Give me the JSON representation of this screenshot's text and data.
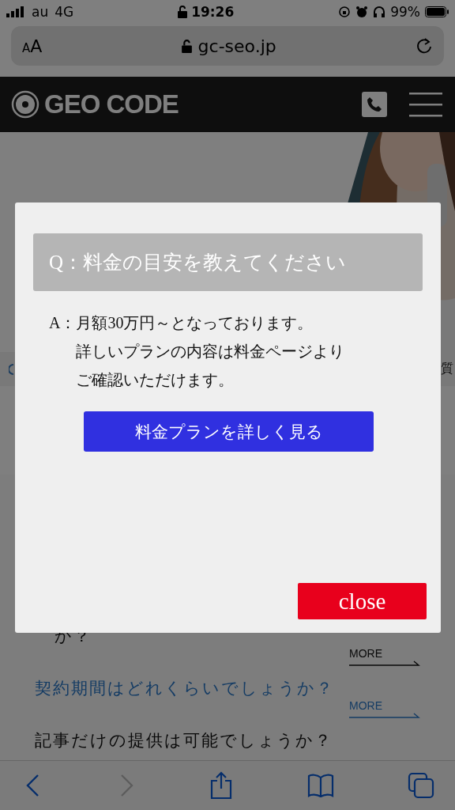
{
  "status_bar": {
    "carrier": "au",
    "network": "4G",
    "time": "19:26",
    "battery": "99%"
  },
  "address_bar": {
    "text_size": "AA",
    "url": "gc-seo.jp"
  },
  "site_header": {
    "logo": "GEO CODE"
  },
  "strip": {
    "text": "質"
  },
  "faq_list": [
    {
      "question": "か？",
      "link": false,
      "more": "MORE"
    },
    {
      "question": "契約期間はどれくらいでしょうか？",
      "link": true,
      "more": "MORE"
    },
    {
      "question": "記事だけの提供は可能でしょうか？",
      "link": false
    }
  ],
  "modal": {
    "question": "Q：料金の目安を教えてください",
    "answer_label": "A：",
    "answer_lines": [
      "月額30万円～となっております。",
      "詳しいプランの内容は料金ページより",
      "ご確認いただけます。"
    ],
    "plan_button": "料金プランを詳しく見る",
    "close_button": "close"
  },
  "toolbar": [
    {
      "kind": "back",
      "disabled": false
    },
    {
      "kind": "forward",
      "disabled": true
    },
    {
      "kind": "share",
      "disabled": false
    },
    {
      "kind": "bookmarks",
      "disabled": false
    },
    {
      "kind": "tabs",
      "disabled": false
    }
  ]
}
